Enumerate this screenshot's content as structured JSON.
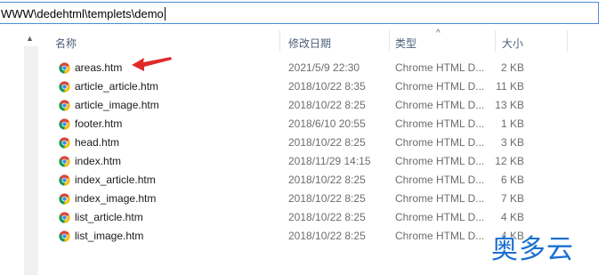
{
  "address": {
    "path": "WWW\\dedehtml\\templets\\demo"
  },
  "columns": {
    "name": "名称",
    "date": "修改日期",
    "type": "类型",
    "size": "大小"
  },
  "files": [
    {
      "name": "areas.htm",
      "date": "2021/5/9 22:30",
      "type": "Chrome HTML D...",
      "size": "2 KB"
    },
    {
      "name": "article_article.htm",
      "date": "2018/10/22 8:35",
      "type": "Chrome HTML D...",
      "size": "11 KB"
    },
    {
      "name": "article_image.htm",
      "date": "2018/10/22 8:25",
      "type": "Chrome HTML D...",
      "size": "13 KB"
    },
    {
      "name": "footer.htm",
      "date": "2018/6/10 20:55",
      "type": "Chrome HTML D...",
      "size": "1 KB"
    },
    {
      "name": "head.htm",
      "date": "2018/10/22 8:25",
      "type": "Chrome HTML D...",
      "size": "3 KB"
    },
    {
      "name": "index.htm",
      "date": "2018/11/29 14:15",
      "type": "Chrome HTML D...",
      "size": "12 KB"
    },
    {
      "name": "index_article.htm",
      "date": "2018/10/22 8:25",
      "type": "Chrome HTML D...",
      "size": "6 KB"
    },
    {
      "name": "index_image.htm",
      "date": "2018/10/22 8:25",
      "type": "Chrome HTML D...",
      "size": "7 KB"
    },
    {
      "name": "list_article.htm",
      "date": "2018/10/22 8:25",
      "type": "Chrome HTML D...",
      "size": "4 KB"
    },
    {
      "name": "list_image.htm",
      "date": "2018/10/22 8:25",
      "type": "Chrome HTML D...",
      "size": "4 KB"
    }
  ],
  "file_icon": "chrome-html-file-icon",
  "annotation": {
    "icon": "red-arrow-icon",
    "color": "#e02a2a"
  },
  "watermark": {
    "text": "奥多云",
    "color": "#1a6fd0"
  },
  "colors": {
    "accent": "#4a8fd8",
    "header_text": "#4c607a",
    "meta_text": "#6d6d6d"
  }
}
